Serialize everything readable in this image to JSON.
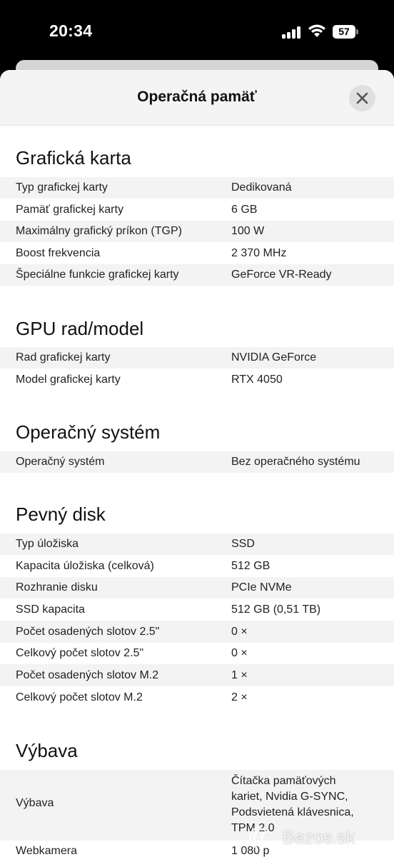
{
  "status": {
    "time": "20:34",
    "battery": "57"
  },
  "sheet": {
    "title": "Operačná pamäť"
  },
  "sections": [
    {
      "title": "Grafická karta",
      "rows": [
        {
          "label": "Typ grafickej karty",
          "value": "Dedikovaná"
        },
        {
          "label": "Pamäť grafickej karty",
          "value": "6 GB"
        },
        {
          "label": "Maximálny grafický príkon (TGP)",
          "value": "100 W"
        },
        {
          "label": "Boost frekvencia",
          "value": "2 370 MHz"
        },
        {
          "label": "Špeciálne funkcie grafickej karty",
          "value": "GeForce VR-Ready"
        }
      ]
    },
    {
      "title": "GPU rad/model",
      "rows": [
        {
          "label": "Rad grafickej karty",
          "value": "NVIDIA GeForce"
        },
        {
          "label": "Model grafickej karty",
          "value": "RTX 4050"
        }
      ]
    },
    {
      "title": "Operačný systém",
      "rows": [
        {
          "label": "Operačný systém",
          "value": "Bez operačného systému"
        }
      ]
    },
    {
      "title": "Pevný disk",
      "rows": [
        {
          "label": "Typ úložiska",
          "value": "SSD"
        },
        {
          "label": "Kapacita úložiska (celková)",
          "value": "512 GB"
        },
        {
          "label": "Rozhranie disku",
          "value": "PCIe NVMe"
        },
        {
          "label": "SSD kapacita",
          "value": "512 GB (0,51 TB)"
        },
        {
          "label": "Počet osadených slotov 2.5\"",
          "value": "0 ×"
        },
        {
          "label": "Celkový počet slotov 2.5\"",
          "value": "0 ×"
        },
        {
          "label": "Počet osadených slotov M.2",
          "value": "1 ×"
        },
        {
          "label": "Celkový počet slotov M.2",
          "value": "2 ×"
        }
      ]
    },
    {
      "title": "Výbava",
      "rows": [
        {
          "label": "Výbava",
          "value_lines": [
            "Čítačka pamäťových",
            "kariet, Nvidia G-SYNC,",
            "Podsvietená klávesnica,",
            "TPM 2.0"
          ]
        },
        {
          "label": "Webkamera",
          "value": "1 080 p"
        }
      ]
    }
  ],
  "watermark": "Bazos.sk"
}
